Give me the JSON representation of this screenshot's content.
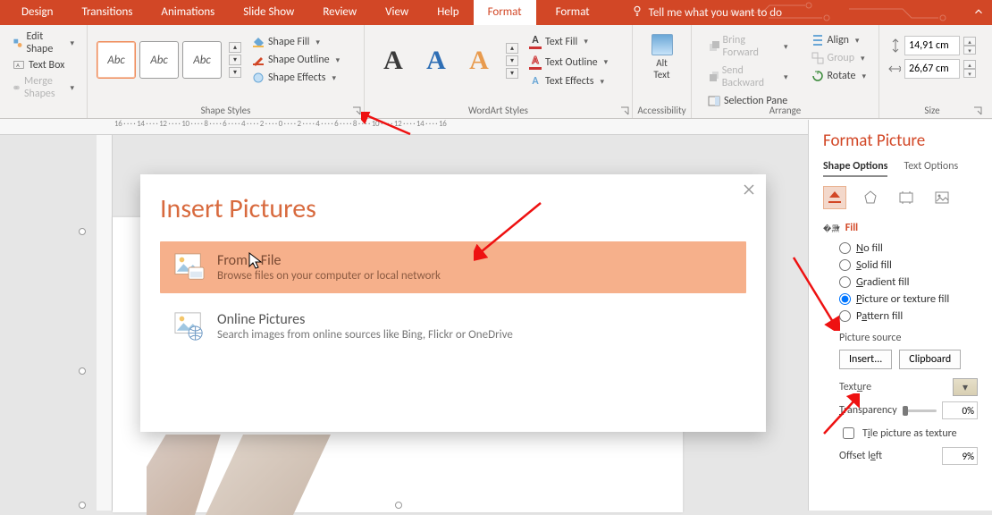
{
  "tabs": {
    "design": "Design",
    "transitions": "Transitions",
    "animations": "Animations",
    "slideshow": "Slide Show",
    "review": "Review",
    "view": "View",
    "help": "Help",
    "format1": "Format",
    "format2": "Format",
    "tell_me": "Tell me what you want to do"
  },
  "ribbon": {
    "insert_shapes": {
      "edit_shape": "Edit Shape",
      "text_box": "Text Box",
      "merge_shapes": "Merge Shapes"
    },
    "shape_styles": {
      "label": "Shape Styles",
      "swatch": "Abc",
      "shape_fill": "Shape Fill",
      "shape_outline": "Shape Outline",
      "shape_effects": "Shape Effects"
    },
    "wordart": {
      "label": "WordArt Styles",
      "text_fill": "Text Fill",
      "text_outline": "Text Outline",
      "text_effects": "Text Effects",
      "sample": "A"
    },
    "accessibility": {
      "label": "Accessibility",
      "alt_text": "Alt\nText",
      "alt1": "Alt",
      "alt2": "Text"
    },
    "arrange": {
      "label": "Arrange",
      "bring_forward": "Bring Forward",
      "send_backward": "Send Backward",
      "selection_pane": "Selection Pane",
      "align": "Align",
      "group": "Group",
      "rotate": "Rotate"
    },
    "size": {
      "label": "Size",
      "height": "14,91 cm",
      "width": "26,67 cm"
    }
  },
  "ruler": "16 · · · · 14 · · · · 12 · · · · 10 · · · · 8 · · · · 6 · · · · 4 · · · · 2 · · · · 0 · · · · 2 · · · · 4 · · · · 6 · · · · 8 · · · · 10 · · · · 12 · · · · 14 · · · · 16",
  "dialog": {
    "title": "Insert Pictures",
    "opt1": {
      "title": "From a File",
      "sub": "Browse files on your computer or local network"
    },
    "opt2": {
      "title": "Online Pictures",
      "sub": "Search images from online sources like Bing, Flickr or OneDrive"
    }
  },
  "pane": {
    "title": "Format Picture",
    "tab_shape": "Shape Options",
    "tab_text": "Text Options",
    "section_fill": "Fill",
    "no_fill": "No fill",
    "solid_fill": "Solid fill",
    "gradient_fill": "Gradient fill",
    "picture_fill": "Picture or texture fill",
    "pattern_fill": "Pattern fill",
    "picture_source": "Picture source",
    "insert_btn": "Insert...",
    "clipboard_btn": "Clipboard",
    "texture": "Texture",
    "transparency": "Transparency",
    "transparency_val": "0%",
    "tile": "Tile picture as texture",
    "offset_left": "Offset left",
    "offset_left_val": "9%"
  }
}
